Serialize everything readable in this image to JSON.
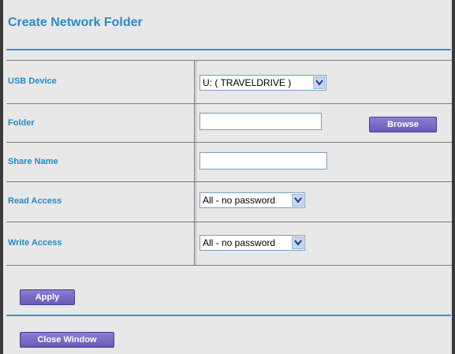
{
  "page": {
    "title": "Create Network Folder"
  },
  "form": {
    "usb_device": {
      "label": "USB Device",
      "value": "U: ( TRAVELDRIVE )"
    },
    "folder": {
      "label": "Folder",
      "value": "",
      "browse_label": "Browse"
    },
    "share_name": {
      "label": "Share Name",
      "value": ""
    },
    "read_access": {
      "label": "Read Access",
      "value": "All - no password"
    },
    "write_access": {
      "label": "Write Access",
      "value": "All - no password"
    }
  },
  "actions": {
    "apply_label": "Apply",
    "close_label": "Close Window"
  },
  "colors": {
    "label": "#1f8bc7",
    "title": "#2a8bc4",
    "rule": "#2a9bd1",
    "button": "#6a5ab8",
    "background": "#e8e8e8"
  }
}
